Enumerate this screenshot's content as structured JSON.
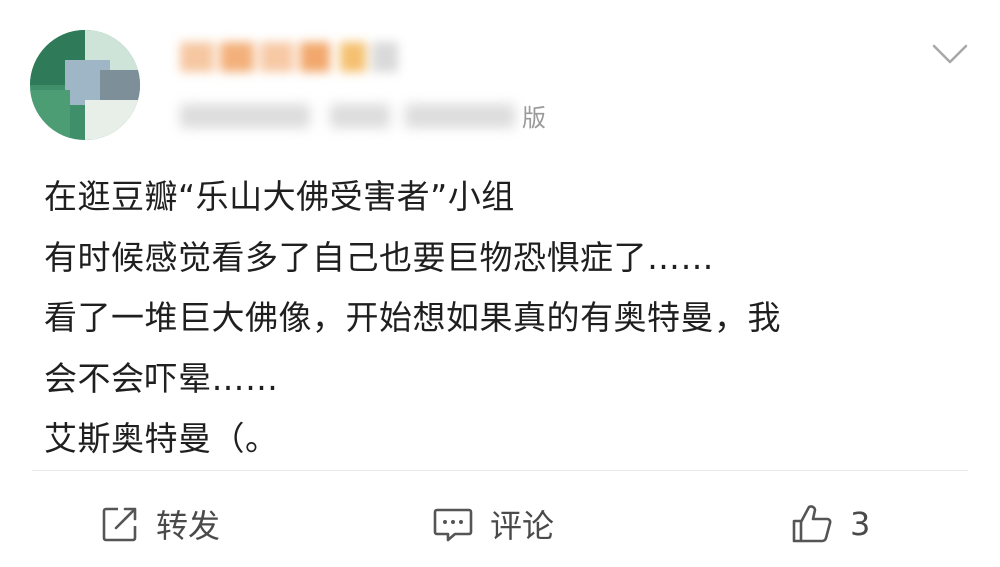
{
  "post": {
    "header": {
      "source_suffix": "版"
    },
    "lines": [
      "在逛豆瓣“乐山大佛受害者”小组",
      "有时候感觉看多了自己也要巨物恐惧症了……",
      "看了一堆巨大佛像，开始想如果真的有奥特曼，我",
      "会不会吓晕……",
      "艾斯奥特曼（。"
    ]
  },
  "actions": {
    "repost_label": "转发",
    "comment_label": "评论",
    "like_count": "3"
  },
  "icons": {
    "more": "chevron-down-icon",
    "repost": "repost-icon",
    "comment": "comment-icon",
    "like": "thumbs-up-icon"
  },
  "colors": {
    "avatar_green": "#3f8f6a",
    "username_orange": "#f3b07a",
    "text": "#1f1f1f",
    "action_text": "#4a4a4a"
  }
}
